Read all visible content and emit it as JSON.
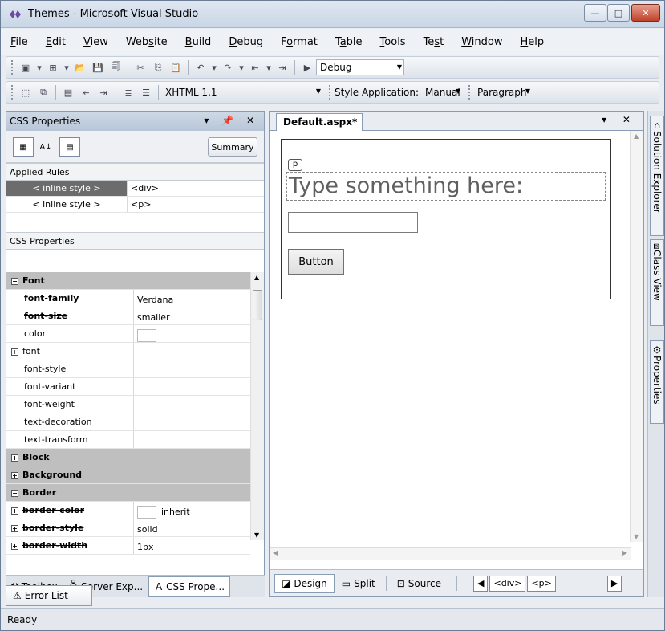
{
  "window": {
    "title": "Themes - Microsoft Visual Studio"
  },
  "menu": [
    {
      "label": "File",
      "key": "F",
      "rest": "ile"
    },
    {
      "label": "Edit",
      "key": "E",
      "rest": "dit"
    },
    {
      "label": "View",
      "key": "V",
      "rest": "iew"
    },
    {
      "label": "Website",
      "pre": "Web",
      "key": "s",
      "rest": "ite"
    },
    {
      "label": "Build",
      "key": "B",
      "rest": "uild"
    },
    {
      "label": "Debug",
      "key": "D",
      "rest": "ebug"
    },
    {
      "label": "Format",
      "pre": "F",
      "key": "o",
      "rest": "rmat"
    },
    {
      "label": "Table",
      "pre": "T",
      "key": "a",
      "rest": "ble"
    },
    {
      "label": "Tools",
      "key": "T",
      "rest": "ools"
    },
    {
      "label": "Test",
      "pre": "Te",
      "key": "s",
      "rest": "t"
    },
    {
      "label": "Window",
      "key": "W",
      "rest": "indow"
    },
    {
      "label": "Help",
      "key": "H",
      "rest": "elp"
    }
  ],
  "toolbar1": {
    "config": "Debug"
  },
  "toolbar2": {
    "doctype": "XHTML 1.1",
    "style_app_label": "Style Application:",
    "style_app_value": "Manual",
    "block_format": "Paragraph"
  },
  "css_panel": {
    "title": "CSS Properties",
    "summary_label": "Summary",
    "applied_rules_label": "Applied Rules",
    "rules": [
      {
        "name": "< inline style >",
        "target": "<div>",
        "selected": true
      },
      {
        "name": "< inline style >",
        "target": "<p>",
        "selected": false
      }
    ],
    "props_label": "CSS Properties",
    "props": [
      {
        "name": "Font",
        "value": "",
        "kind": "cat",
        "exp": "−"
      },
      {
        "name": "font-family",
        "value": "Verdana",
        "kind": "bold"
      },
      {
        "name": "font-size",
        "value": "smaller",
        "kind": "strike"
      },
      {
        "name": "color",
        "value": "",
        "kind": "color"
      },
      {
        "name": "font",
        "value": "",
        "kind": "exp",
        "exp": "+"
      },
      {
        "name": "font-style",
        "value": "",
        "kind": "plain"
      },
      {
        "name": "font-variant",
        "value": "",
        "kind": "plain"
      },
      {
        "name": "font-weight",
        "value": "",
        "kind": "plain"
      },
      {
        "name": "text-decoration",
        "value": "",
        "kind": "plain"
      },
      {
        "name": "text-transform",
        "value": "",
        "kind": "plain"
      },
      {
        "name": "Block",
        "value": "",
        "kind": "cat",
        "exp": "+"
      },
      {
        "name": "Background",
        "value": "",
        "kind": "cat",
        "exp": "+"
      },
      {
        "name": "Border",
        "value": "",
        "kind": "cat",
        "exp": "−"
      },
      {
        "name": "border-color",
        "value": "inherit",
        "kind": "strikeexp-color",
        "exp": "+"
      },
      {
        "name": "border-style",
        "value": "solid",
        "kind": "strikeexp",
        "exp": "+"
      },
      {
        "name": "border-width",
        "value": "1px",
        "kind": "strikeexp",
        "exp": "+"
      }
    ],
    "tabs": [
      "Toolbox",
      "Server Exp...",
      "CSS Prope..."
    ]
  },
  "error_tab": "Error List",
  "document": {
    "tab": "Default.aspx*",
    "ptag": "p",
    "heading": "Type something here:",
    "button": "Button",
    "views": [
      "Design",
      "Split",
      "Source"
    ],
    "tags": [
      "<div>",
      "<p>"
    ]
  },
  "side_tabs": [
    "Solution Explorer",
    "Class View",
    "Properties"
  ],
  "status": "Ready"
}
